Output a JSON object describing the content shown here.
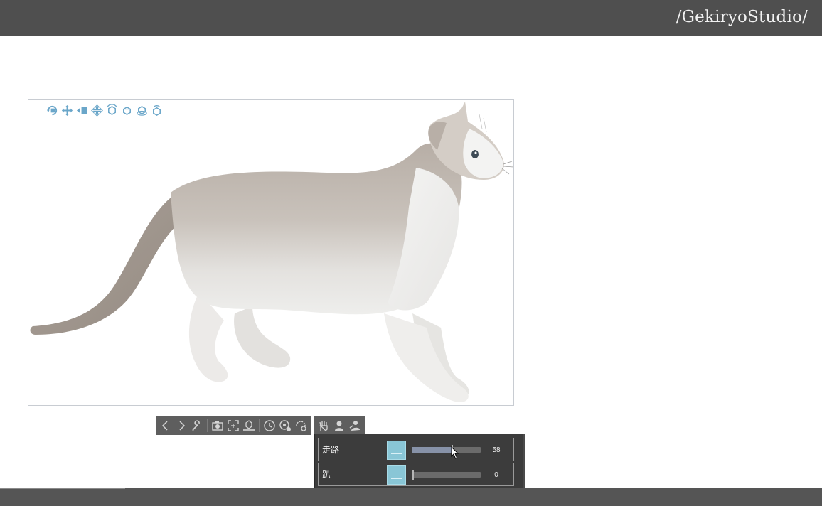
{
  "header": {
    "brand": "/GekiryoStudio/"
  },
  "canvas_toolbar": {
    "icons": [
      "camera-rotate-icon",
      "camera-pan-icon",
      "camera-dolly-icon",
      "object-move-icon",
      "object-rotate-icon",
      "object-rotate-x-icon",
      "object-rotate-y-icon",
      "object-rotate-z-icon"
    ]
  },
  "bottom_toolbar": {
    "group1": [
      "previous-icon",
      "next-icon",
      "wrench-icon",
      "camera-icon",
      "fit-to-view-icon",
      "ground-icon",
      "pose-reset-icon",
      "rotation-reset-icon",
      "all-reset-icon"
    ],
    "group2": [
      "pose-hand-icon",
      "pose-bust-icon",
      "pose-body-icon"
    ]
  },
  "pose_panel": {
    "rows": [
      {
        "name": "走路",
        "value": "58",
        "fraction": 0.58
      },
      {
        "name": "趴",
        "value": "0",
        "fraction": 0.0
      }
    ]
  },
  "colors": {
    "top_bar": "#4f4f4f",
    "icon_blue": "#6aa6c9",
    "panel_bg": "#3c3c3c",
    "slider_fill": "#8792a8",
    "thumb": "#89c6d6"
  }
}
